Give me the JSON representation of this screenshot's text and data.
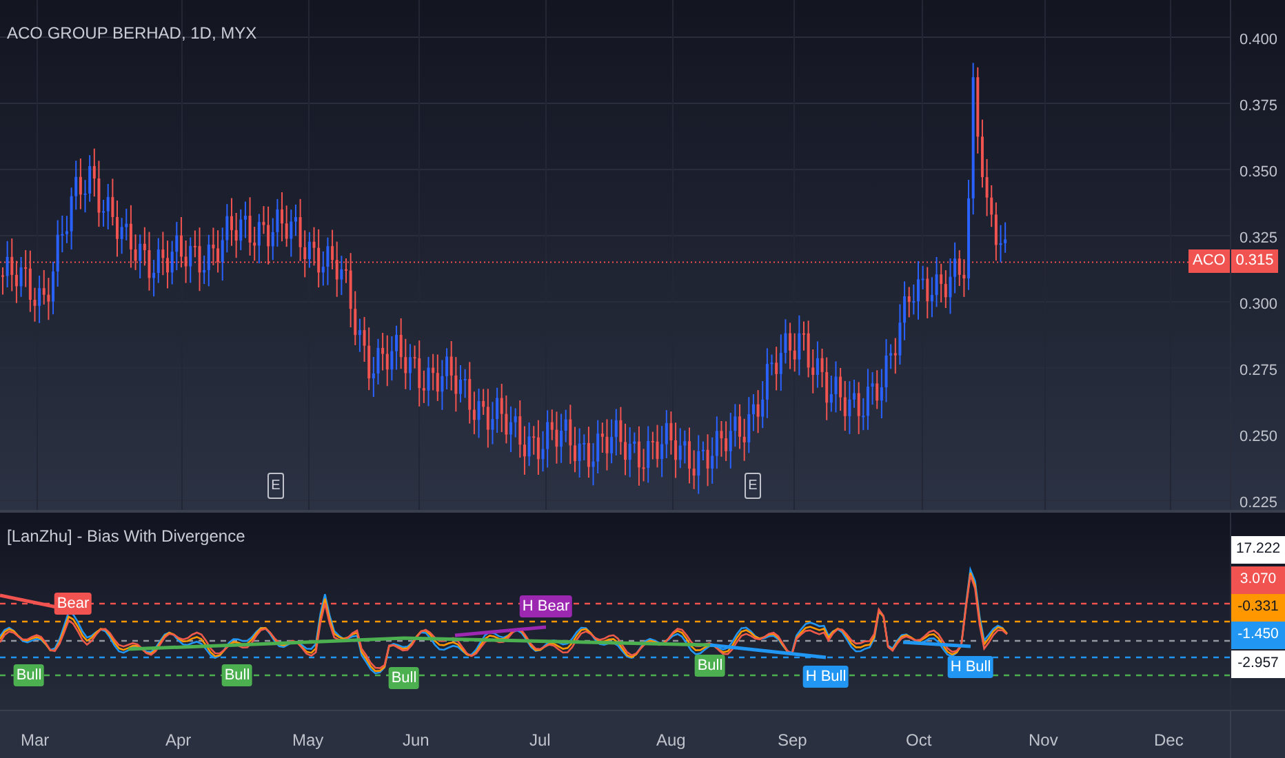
{
  "chart": {
    "title": "ACO GROUP BERHAD, 1D, MYX",
    "price_axis": [
      "0.400",
      "0.375",
      "0.350",
      "0.325",
      "0.300",
      "0.275",
      "0.250",
      "0.225"
    ],
    "last_price": {
      "symbol": "ACO",
      "value": "0.315",
      "color": "#f05350"
    },
    "event_markers": [
      "E",
      "E"
    ]
  },
  "indicator": {
    "title": "[LanZhu] - Bias With Divergence",
    "axis_values": [
      {
        "value": "17.222",
        "color": "#ffffff"
      },
      {
        "value": "3.070",
        "color": "#f05350"
      },
      {
        "value": "-0.331",
        "color": "#ff9800"
      },
      {
        "value": "-1.450",
        "color": "#2196f3"
      },
      {
        "value": "-2.957",
        "color": "#ffffff"
      }
    ],
    "divergence_labels": [
      {
        "text": "Bear",
        "color": "#f05350"
      },
      {
        "text": "Bull",
        "color": "#4caf50"
      },
      {
        "text": "Bull",
        "color": "#4caf50"
      },
      {
        "text": "Bull",
        "color": "#4caf50"
      },
      {
        "text": "H Bear",
        "color": "#9c27b0"
      },
      {
        "text": "Bull",
        "color": "#4caf50"
      },
      {
        "text": "H Bull",
        "color": "#2196f3"
      },
      {
        "text": "H Bull",
        "color": "#2196f3"
      }
    ]
  },
  "time_axis": [
    "Mar",
    "Apr",
    "May",
    "Jun",
    "Jul",
    "Aug",
    "Sep",
    "Oct",
    "Nov",
    "Dec"
  ]
}
